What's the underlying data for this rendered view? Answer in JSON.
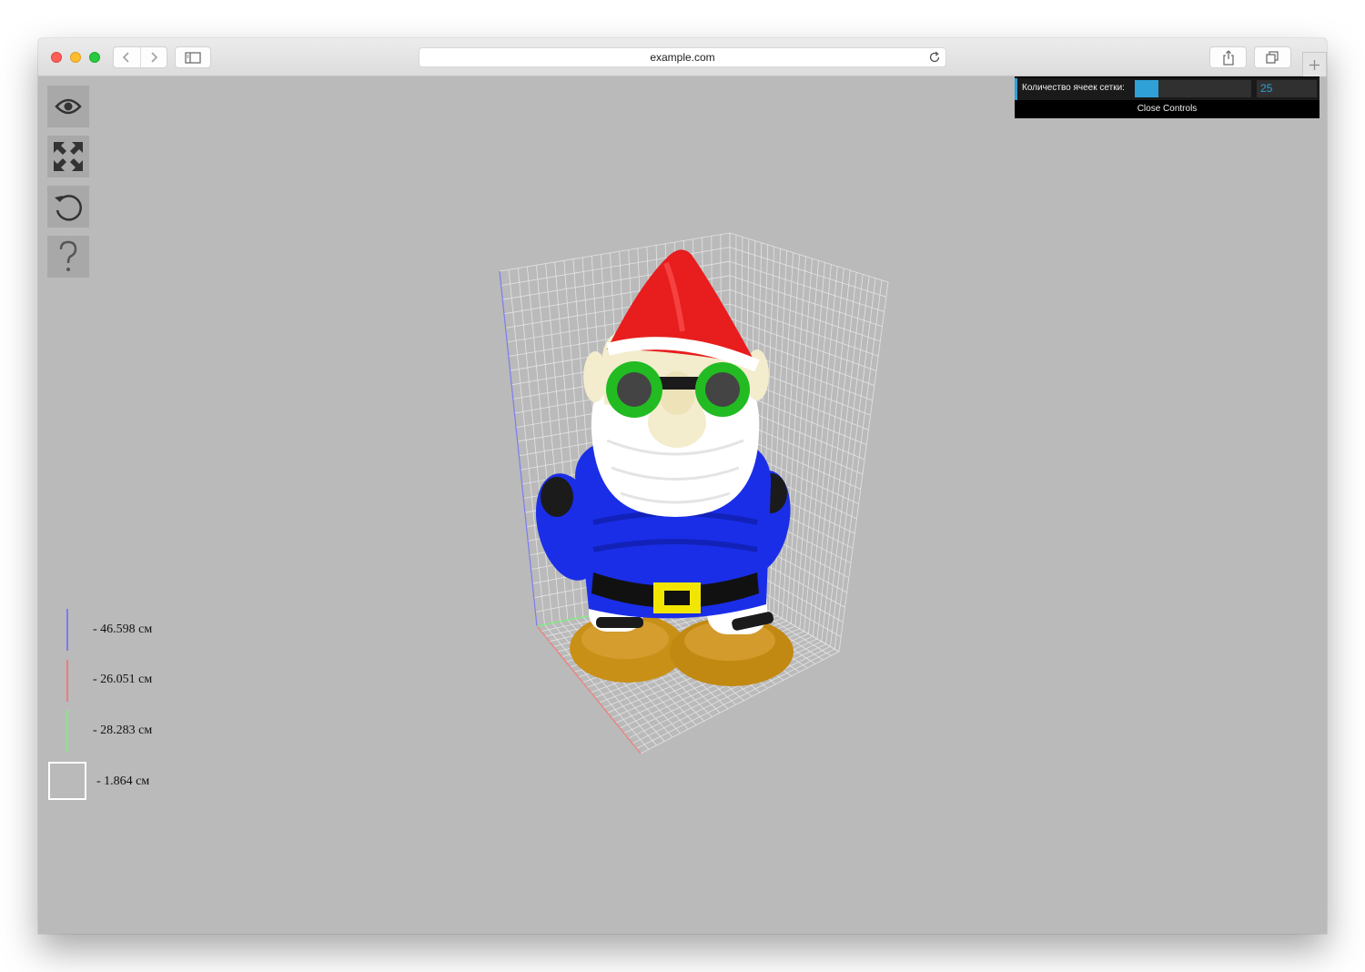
{
  "browser": {
    "url": "example.com"
  },
  "toolbar": {
    "buttons": [
      {
        "name": "view",
        "icon": "eye-icon"
      },
      {
        "name": "fullscreen",
        "icon": "expand-arrows-icon"
      },
      {
        "name": "reset",
        "icon": "rotate-icon"
      },
      {
        "name": "help",
        "icon": "question-icon"
      }
    ]
  },
  "controls": {
    "grid_cells_label": "Количество ячеек сетки:",
    "grid_cells_value": "25",
    "grid_cells_fraction": 0.2,
    "close_label": "Close Controls"
  },
  "dimensions": {
    "height": "- 46.598 см",
    "width": "- 26.051 см",
    "depth": "- 28.283 см",
    "cell": "- 1.864 см"
  },
  "colors": {
    "background": "#bababa",
    "accent": "#2fa1d6",
    "axis_height": "#7b7bf0",
    "axis_width": "#f07b7b",
    "axis_depth": "#7bf07b",
    "hat": "#e81d1d",
    "goggles": "#22bb22",
    "shirt": "#1a2ee8",
    "beard": "#ffffff",
    "skin": "#f3eccd",
    "boots": "#c99018",
    "buckle": "#f2e600"
  }
}
